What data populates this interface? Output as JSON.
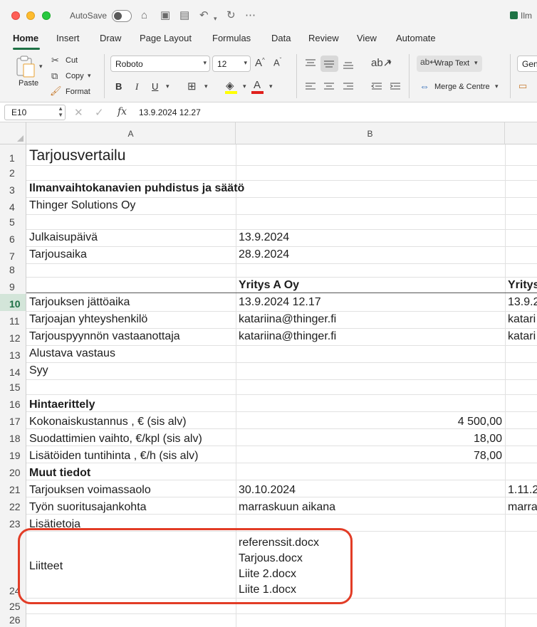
{
  "titlebar": {
    "autosave_label": "AutoSave",
    "doc_title": "Ilm"
  },
  "tabs": [
    "Home",
    "Insert",
    "Draw",
    "Page Layout",
    "Formulas",
    "Data",
    "Review",
    "View",
    "Automate"
  ],
  "ribbon": {
    "paste_label": "Paste",
    "cut_label": "Cut",
    "copy_label": "Copy",
    "format_label": "Format",
    "font_name": "Roboto",
    "font_size": "12",
    "wrap_text_label": "Wrap Text",
    "merge_label": "Merge & Centre",
    "number_format": "Gen",
    "accent_color": "#1e7145",
    "highlight_color": "#ffff00",
    "font_color": "#e0201c"
  },
  "formula_bar": {
    "cell_ref": "E10",
    "value": "13.9.2024 12.27"
  },
  "columns": [
    "A",
    "B"
  ],
  "rows": [
    "1",
    "2",
    "3",
    "4",
    "5",
    "6",
    "7",
    "8",
    "9",
    "10",
    "11",
    "12",
    "13",
    "14",
    "15",
    "16",
    "17",
    "18",
    "19",
    "20",
    "21",
    "22",
    "23",
    "24",
    "25",
    "26"
  ],
  "selected_row": "10",
  "cells": {
    "a1": "Tarjousvertailu",
    "a3": "Ilmanvaihtokanavien puhdistus ja säätö",
    "a4": "Thinger Solutions Oy",
    "a6": "Julkaisupäivä",
    "b6": "13.9.2024",
    "a7": "Tarjousaika",
    "b7": "28.9.2024",
    "b9": "Yritys A Oy",
    "c9": "Yritys",
    "a10": "Tarjouksen jättöaika",
    "b10": "13.9.2024 12.17",
    "c10": "13.9.2",
    "a11": "Tarjoajan yhteyshenkilö",
    "b11": "katariina@thinger.fi",
    "c11": "katari",
    "a12": "Tarjouspyynnön vastaanottaja",
    "b12": "katariina@thinger.fi",
    "c12": "katari",
    "a13": "Alustava vastaus",
    "a14": "Syy",
    "a16": "Hintaerittely",
    "a17": "Kokonaiskustannus , €  (sis alv)",
    "b17": "4 500,00",
    "a18": "Suodattimien vaihto, €/kpl (sis alv)",
    "b18": "18,00",
    "a19": "Lisätöiden tuntihinta , €/h (sis alv)",
    "b19": "78,00",
    "a20": "Muut tiedot",
    "a21": "Tarjouksen voimassaolo",
    "b21": "30.10.2024",
    "c21": "1.11.2",
    "a22": "Työn suoritusajankohta",
    "b22": "marraskuun aikana",
    "c22": "marra",
    "a23": "Lisätietoja",
    "a24": "Liitteet",
    "b24_files": [
      "referenssit.docx",
      "Tarjous.docx",
      "Liite 2.docx",
      "Liite 1.docx"
    ]
  }
}
